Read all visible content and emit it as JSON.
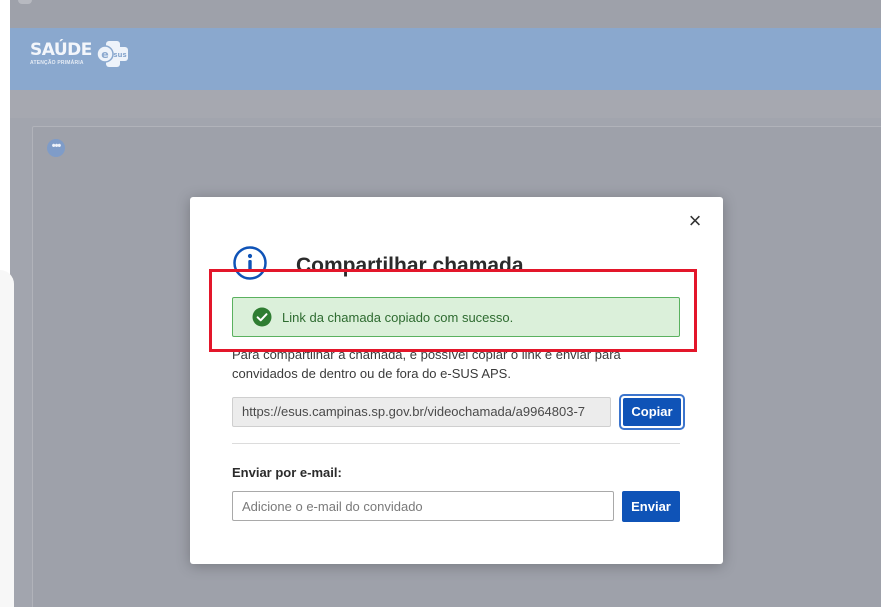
{
  "header": {
    "logo_main": "SAÚDE",
    "logo_sub": "ATENÇÃO PRIMÁRIA",
    "logo_badge": "sus",
    "logo_badge_prefix": "e"
  },
  "panel": {
    "more_label": "•••"
  },
  "modal": {
    "close_label": "×",
    "title": "Compartilhar chamada",
    "alert_message": "Link da chamada copiado com sucesso.",
    "description": "Para compartilhar a chamada, é possível copiar o link e enviar para convidados de dentro ou de fora do e-SUS APS.",
    "link_value": "https://esus.campinas.sp.gov.br/videochamada/a9964803-7",
    "copy_label": "Copiar",
    "email_label": "Enviar por e-mail:",
    "email_placeholder": "Adicione o e-mail do convidado",
    "send_label": "Enviar"
  },
  "colors": {
    "primary": "#0f53b7",
    "header": "#8aa8ce",
    "success_bg": "#dbf0da",
    "success_border": "#5ab15f",
    "highlight": "#e3162a"
  }
}
